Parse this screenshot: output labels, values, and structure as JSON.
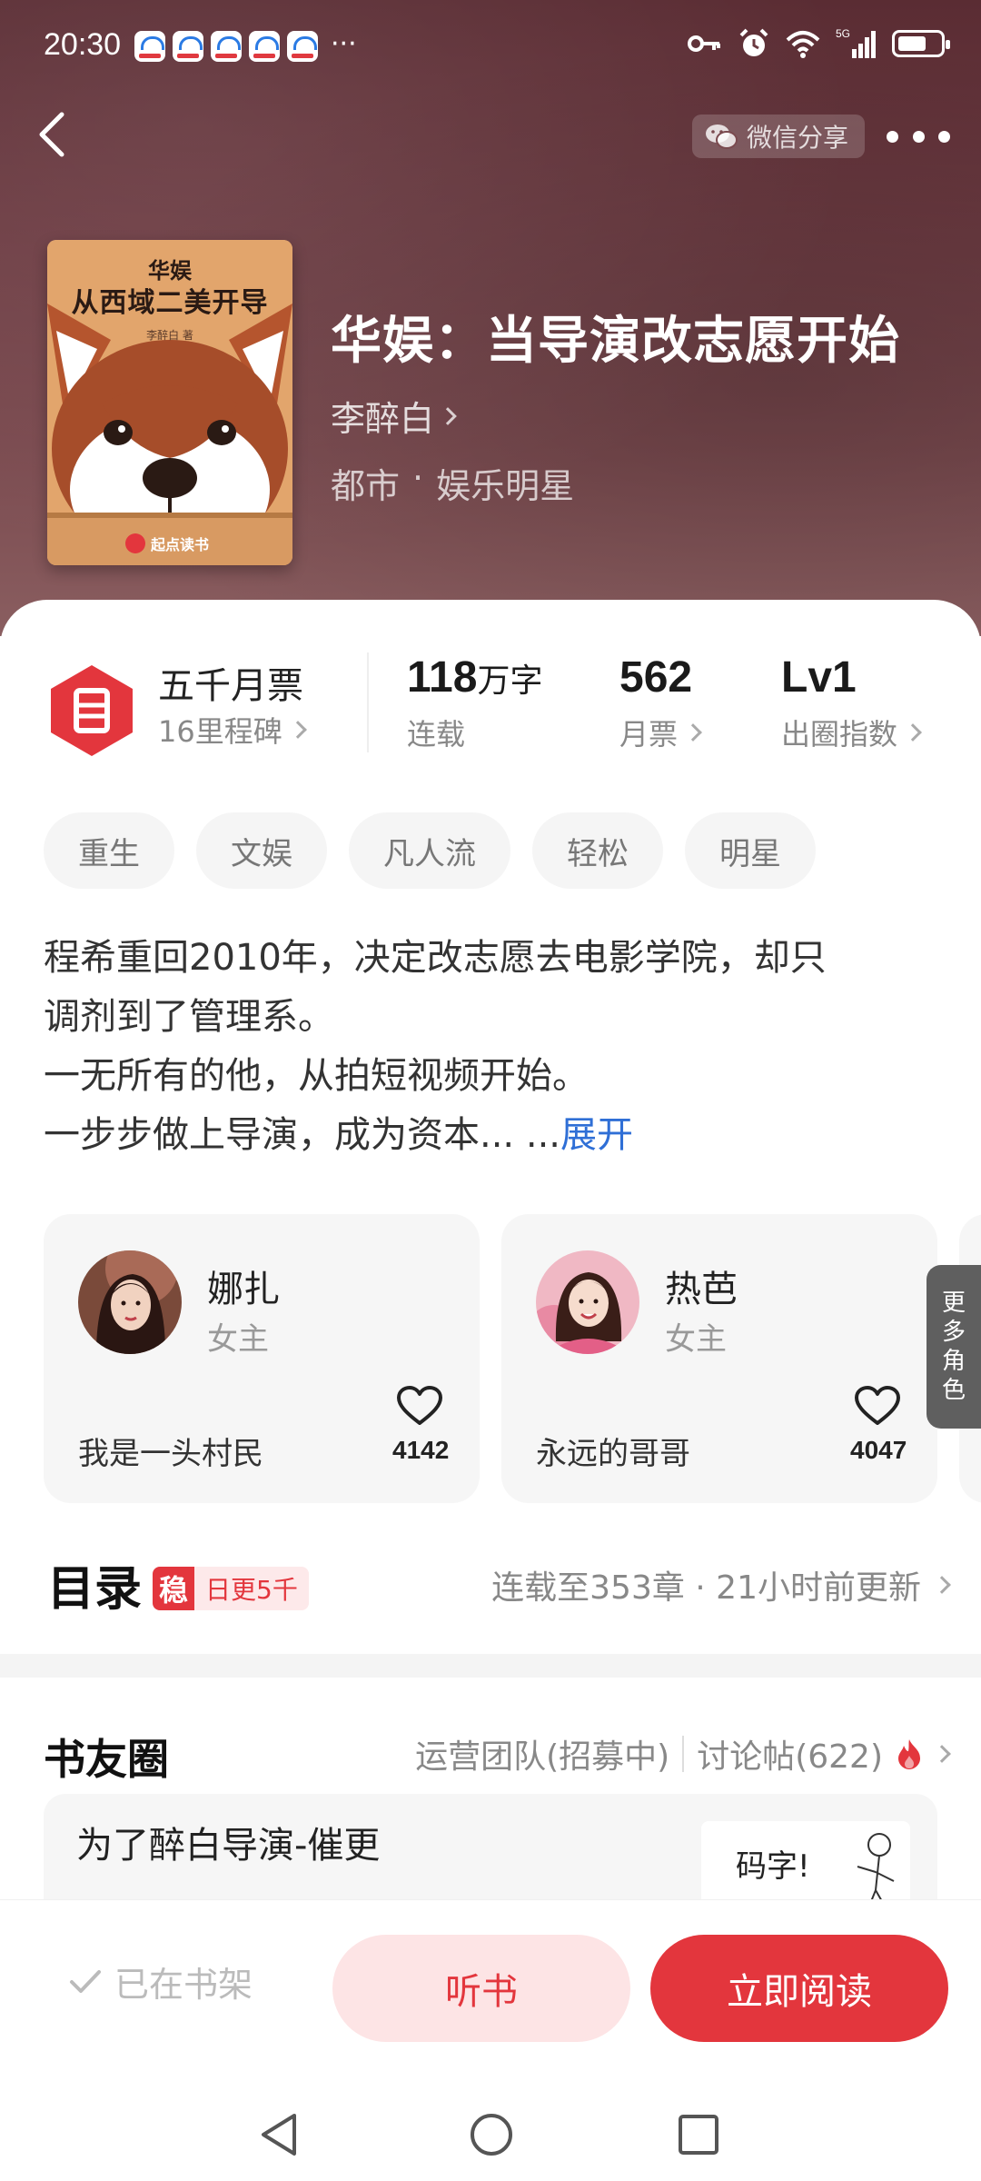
{
  "status_bar": {
    "time": "20:30",
    "more": "···",
    "network": "5G"
  },
  "header": {
    "share_label": "微信分享"
  },
  "book": {
    "title": "华娱：当导演改志愿开始",
    "author": "李醉白",
    "genre": [
      "都市",
      "·",
      "娱乐明星"
    ],
    "cover": {
      "top_text": "华娱",
      "main_text": "从西域二美开导",
      "author_text": "李醉白 著",
      "brand_text": "起点读书"
    }
  },
  "stats": {
    "ticket_title": "五千月票",
    "ticket_sub": "16里程碑",
    "badge_glyph": "日",
    "words_value": "118",
    "words_unit": "万字",
    "words_label": "连载",
    "monthly_value": "562",
    "monthly_label": "月票",
    "level_value": "Lv1",
    "level_label": "出圈指数"
  },
  "tags": [
    "重生",
    "文娱",
    "凡人流",
    "轻松",
    "明星"
  ],
  "synopsis": {
    "lines": [
      "程希重回2010年，决定改志愿去电影学院，却只",
      "调剂到了管理系。",
      "一无所有的他，从拍短视频开始。",
      "一步步做上导演，成为资本... ..."
    ],
    "expand_label": "展开"
  },
  "characters": [
    {
      "name": "娜扎",
      "role": "女主",
      "quote": "我是一头村民",
      "likes": "4142"
    },
    {
      "name": "热芭",
      "role": "女主",
      "quote": "永远的哥哥",
      "likes": "4047"
    }
  ],
  "more_roles_label": "更多角色",
  "catalog": {
    "title": "目录",
    "stable_mark": "稳",
    "stable_text": "日更5千",
    "status": "连载至353章 · 21小时前更新"
  },
  "book_circle": {
    "title": "书友圈",
    "team_link": "运营团队(招募中)",
    "discuss_link": "讨论帖(622)",
    "post_title": "为了醉白导演-催更",
    "thumb_text": "码字!"
  },
  "actions": {
    "shelf_label": "已在书架",
    "listen_label": "听书",
    "read_label": "立即阅读"
  },
  "colors": {
    "accent": "#e3363d",
    "accent_light": "#fde4e5",
    "link": "#2f6fd6"
  }
}
